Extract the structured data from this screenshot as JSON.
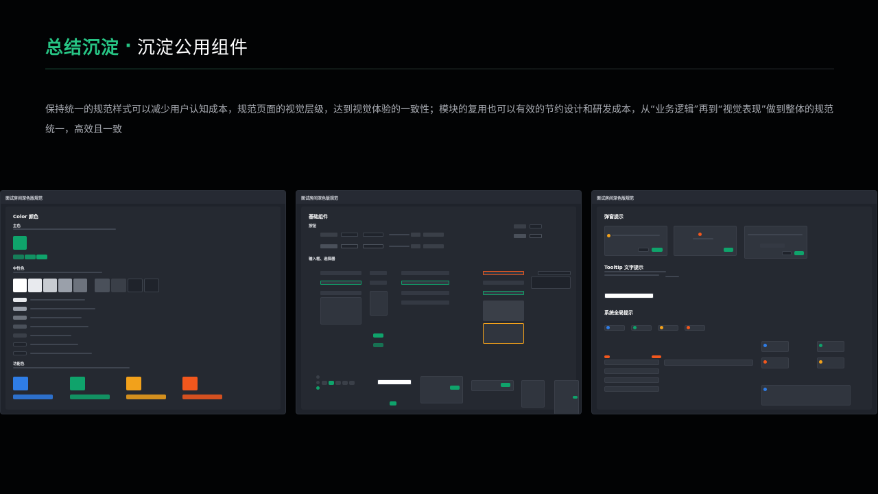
{
  "header": {
    "title_accent": "总结沉淀",
    "title_dot": "·",
    "title_main": "沉淀公用组件"
  },
  "description": "保持统一的规范样式可以减少用户认知成本，规范页面的视觉层级，达到视觉体验的一致性；模块的复用也可以有效的节约设计和研发成本，从“业务逻辑”再到“视觉表现”做到整体的规范统一，高效且一致",
  "panels": [
    {
      "bar_title": "面试房间深色版规范",
      "section_title": "Color 颜色",
      "primary_label": "主色",
      "neutral_label": "中性色",
      "functional_label": "功能色"
    },
    {
      "bar_title": "面试房间深色版规范",
      "section_title": "基础组件",
      "buttons_label": "按钮",
      "inputs_label": "输入框、选择器"
    },
    {
      "bar_title": "面试房间深色版规范",
      "popup_label": "弹窗提示",
      "tooltip_label": "Tooltip 文字提示",
      "system_label": "系统全局提示"
    }
  ],
  "colors": {
    "accent": "#27c484",
    "green": "#0fa36b",
    "blue": "#2f7de6",
    "orange": "#f2a11b",
    "red": "#f2571d",
    "panel_bg": "#1f232b"
  }
}
